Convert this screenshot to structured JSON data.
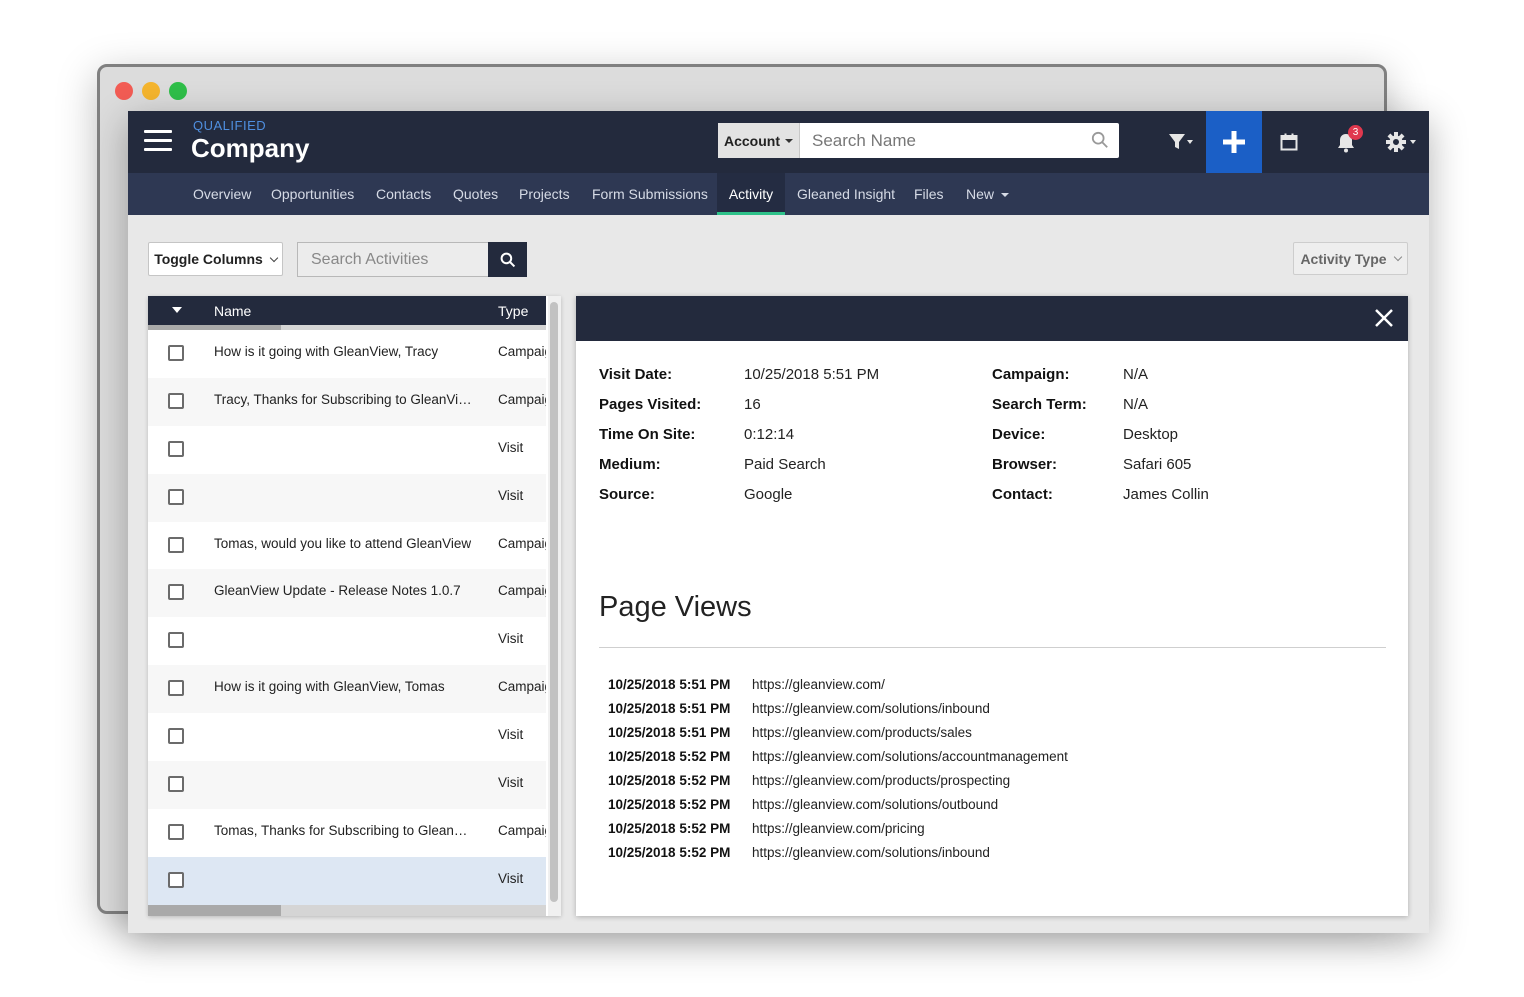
{
  "header": {
    "brand_small": "QUALIFIED",
    "brand_title": "Company",
    "account_label": "Account",
    "search_placeholder": "Search Name",
    "notification_count": "3",
    "accent_color": "#1b5fc6"
  },
  "tabs": [
    {
      "label": "Overview"
    },
    {
      "label": "Opportunities"
    },
    {
      "label": "Contacts"
    },
    {
      "label": "Quotes"
    },
    {
      "label": "Projects"
    },
    {
      "label": "Form Submissions"
    },
    {
      "label": "Activity",
      "active": true
    },
    {
      "label": "Gleaned Insight"
    },
    {
      "label": "Files"
    },
    {
      "label": "New"
    }
  ],
  "toolbar": {
    "toggle_columns_label": "Toggle Columns",
    "search_placeholder": "Search Activities",
    "activity_type_label": "Activity Type"
  },
  "activity_list": {
    "columns": [
      "Name",
      "Type"
    ],
    "rows": [
      {
        "name": "How is it going with GleanView, Tracy",
        "type": "Campaign"
      },
      {
        "name": "Tracy, Thanks for Subscribing to GleanView",
        "type": "Campaign"
      },
      {
        "name": "",
        "type": "Visit"
      },
      {
        "name": "",
        "type": "Visit"
      },
      {
        "name": "Tomas, would you like to attend GleanView",
        "type": "Campaign"
      },
      {
        "name": "GleanView Update - Release Notes 1.0.7",
        "type": "Campaign"
      },
      {
        "name": "",
        "type": "Visit"
      },
      {
        "name": "How is it going with GleanView, Tomas",
        "type": "Campaign"
      },
      {
        "name": "",
        "type": "Visit"
      },
      {
        "name": "",
        "type": "Visit"
      },
      {
        "name": "Tomas, Thanks for Subscribing to GleanView",
        "type": "Campaign"
      },
      {
        "name": "",
        "type": "Visit",
        "selected": true
      }
    ]
  },
  "detail": {
    "left_fields": [
      {
        "label": "Visit Date:",
        "value": "10/25/2018 5:51 PM"
      },
      {
        "label": "Pages Visited:",
        "value": "16"
      },
      {
        "label": "Time On Site:",
        "value": "0:12:14"
      },
      {
        "label": "Medium:",
        "value": "Paid Search"
      },
      {
        "label": "Source:",
        "value": "Google"
      }
    ],
    "right_fields": [
      {
        "label": "Campaign:",
        "value": "N/A"
      },
      {
        "label": "Search Term:",
        "value": "N/A"
      },
      {
        "label": "Device:",
        "value": "Desktop"
      },
      {
        "label": "Browser:",
        "value": "Safari 605"
      },
      {
        "label": "Contact:",
        "value": "James Collin"
      }
    ],
    "page_views_title": "Page Views",
    "page_views": [
      {
        "date": "10/25/2018 5:51 PM",
        "url": "https://gleanview.com/"
      },
      {
        "date": "10/25/2018 5:51 PM",
        "url": "https://gleanview.com/solutions/inbound"
      },
      {
        "date": "10/25/2018 5:51 PM",
        "url": "https://gleanview.com/products/sales"
      },
      {
        "date": "10/25/2018 5:52 PM",
        "url": "https://gleanview.com/solutions/accountmanagement"
      },
      {
        "date": "10/25/2018 5:52 PM",
        "url": "https://gleanview.com/products/prospecting"
      },
      {
        "date": "10/25/2018 5:52 PM",
        "url": "https://gleanview.com/solutions/outbound"
      },
      {
        "date": "10/25/2018 5:52 PM",
        "url": "https://gleanview.com/pricing"
      },
      {
        "date": "10/25/2018 5:52 PM",
        "url": "https://gleanview.com/solutions/inbound"
      }
    ]
  }
}
